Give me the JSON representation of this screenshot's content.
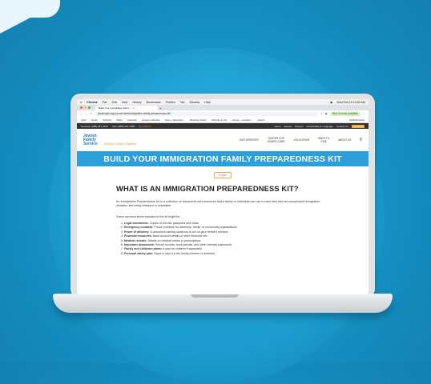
{
  "os_menu": {
    "apple": "",
    "app": "Chrome",
    "items": [
      "File",
      "Edit",
      "View",
      "History",
      "Bookmarks",
      "Profiles",
      "Tab",
      "Window",
      "Help"
    ],
    "clock": "Wed Feb 19 10:53 AM"
  },
  "browser": {
    "tab_title": "Build Your Immigration Fami...",
    "url": "jewishnyfs.org/our-services/immigration-family-preparedness-kit/",
    "update_label": "New Chrome available",
    "bookmarks": [
      "Apps",
      "Gmail",
      "YouTube",
      "Maps",
      "Calendar",
      "Google Calendar",
      "How to Schedule...",
      "Reading Library",
      "Website to Vet",
      "Career + Leaders...",
      "Grants"
    ],
    "bookmarks_right": "All Bookmarks"
  },
  "site": {
    "strip_left": "Services: (888) 687-7878",
    "strip_mid": "Give: (888) 687-7888",
    "strip_hl": "5 Locations",
    "strip_links": [
      "Home",
      "Events",
      "Careers",
      "Accessibility & Language",
      "Contact Us"
    ],
    "donate": "DONATE",
    "logo_lines": [
      "Jewish",
      "Family",
      "Service"
    ],
    "tagline": "Moving Forward Together",
    "nav": [
      "OUR SERVICES",
      "CENTER FOR JEWISH CARE",
      "VOLUNTEER",
      "WAYS TO GIVE",
      "ABOUT US"
    ],
    "hero": "BUILD YOUR IMMIGRATION FAMILY PREPAREDNESS KIT",
    "language": "English",
    "heading": "WHAT IS AN IMMIGRATION PREPAREDNESS KIT?",
    "intro": "An Immigration Preparedness Kit is a collection of documents and resources that a family or individual can use in case they face an unexpected immigration situation, like being detained or separated.",
    "list_intro": "Some common items included in the kit might be:",
    "items": [
      {
        "label": "Legal documents:",
        "text": "Copies of IDs like passports and visas."
      },
      {
        "label": "Emergency contacts:",
        "text": "Phone numbers for attorneys, family, or community organizations."
      },
      {
        "label": "Power of attorney:",
        "text": "A document naming someone to act on your behalf if needed."
      },
      {
        "label": "Financial resources:",
        "text": "Bank account details or other financial info."
      },
      {
        "label": "Medical records:",
        "text": "Details on medical needs or prescriptions."
      },
      {
        "label": "Important documents:",
        "text": "School records, work permits, and other relevant paperwork."
      },
      {
        "label": "Family and childcare plans:",
        "text": "A plan for children if separated."
      },
      {
        "label": "Personal safety plan:",
        "text": "Steps to take if a the family member is detained."
      }
    ]
  },
  "colors": {
    "background": "#1795c8",
    "hero": "#2a9fd8",
    "accent": "#f4a531",
    "logo": "#1c78bd"
  }
}
